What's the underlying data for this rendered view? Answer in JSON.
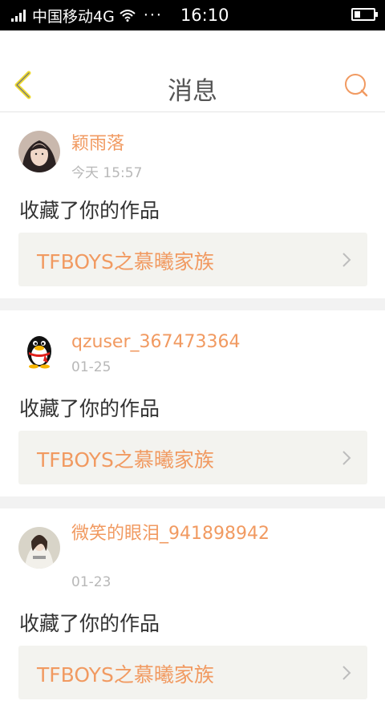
{
  "status_bar": {
    "carrier": "中国移动4G",
    "dots": "···",
    "time": "16:10"
  },
  "nav": {
    "title": "消息",
    "back_icon": "chevron-left-icon",
    "search_icon": "search-icon",
    "accent_color": "#f19a61"
  },
  "messages": [
    {
      "username": "颖雨落",
      "time": "今天 15:57",
      "action": "收藏了你的作品",
      "work_title": "TFBOYS之慕曦家族",
      "avatar": "girl-photo-avatar"
    },
    {
      "username": "qzuser_367473364",
      "time": "01-25",
      "action": "收藏了你的作品",
      "work_title": "TFBOYS之慕曦家族",
      "avatar": "penguin-avatar"
    },
    {
      "username": "微笑的眼泪_941898942",
      "time": "01-23",
      "action": "收藏了你的作品",
      "work_title": "TFBOYS之慕曦家族",
      "avatar": "girl-photo-avatar"
    }
  ]
}
